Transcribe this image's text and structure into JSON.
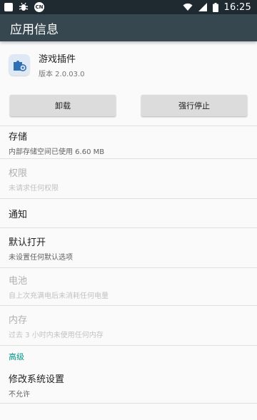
{
  "status_bar": {
    "icons": [
      "notification-square-icon",
      "bug-icon",
      "cn-badge-icon",
      "wifi-icon",
      "signal-icon",
      "battery-icon"
    ],
    "cn_text": "CN",
    "time": "16:25"
  },
  "app_bar": {
    "title": "应用信息"
  },
  "app": {
    "name": "游戏插件",
    "version": "版本 2.0.03.0",
    "icon": "puzzle-gear-icon"
  },
  "buttons": {
    "uninstall": "卸载",
    "force_stop": "强行停止"
  },
  "items": [
    {
      "title": "存储",
      "subtitle": "内部存储空间已使用 6.60 MB",
      "enabled": true
    },
    {
      "title": "权限",
      "subtitle": "未请求任何权限",
      "enabled": false
    },
    {
      "title": "通知",
      "subtitle": "",
      "enabled": true
    },
    {
      "title": "默认打开",
      "subtitle": "未设置任何默认选项",
      "enabled": true
    },
    {
      "title": "电池",
      "subtitle": "自上次充满电后未消耗任何电量",
      "enabled": false
    },
    {
      "title": "内存",
      "subtitle": "过去 3 小时内未使用任何内存",
      "enabled": false
    }
  ],
  "advanced_section": {
    "label": "高级"
  },
  "advanced_items": [
    {
      "title": "修改系统设置",
      "subtitle": "不允许",
      "enabled": true
    }
  ],
  "colors": {
    "status_bar": "#1f2a30",
    "app_bar": "#37474f",
    "accent": "#009688",
    "background": "#fafafa"
  }
}
